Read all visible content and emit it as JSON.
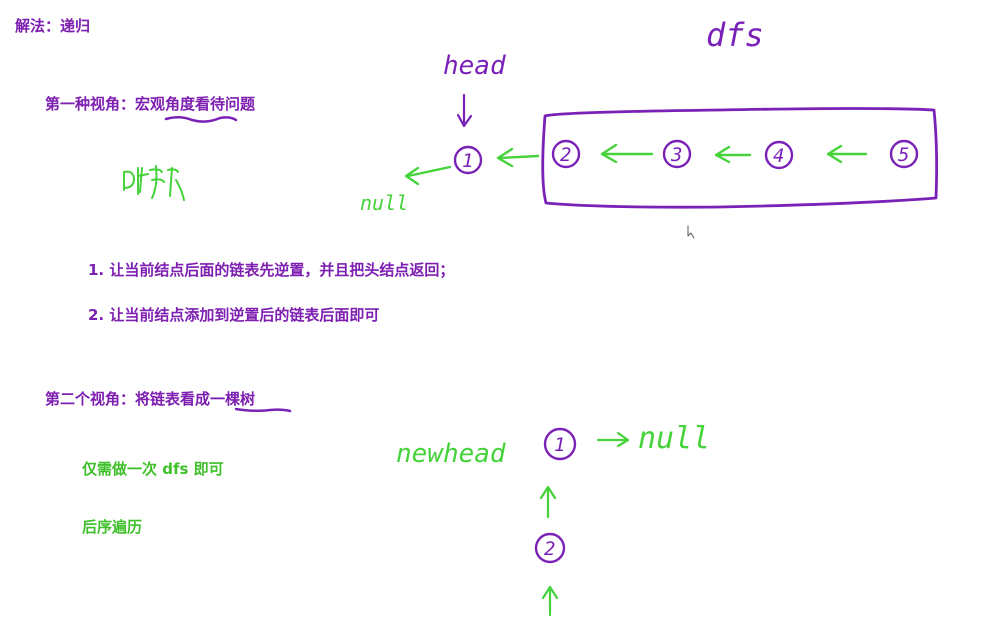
{
  "colors": {
    "purple": "#7d1fb0",
    "green": "#3fc02a",
    "ink_purple": "#7a22b8",
    "ink_green": "#45d23a"
  },
  "title": "解法：递归",
  "perspective1": {
    "heading_prefix": "第一种视角：",
    "heading_emph": "宏观角度",
    "heading_suffix": "看待问题",
    "step1": "1. 让当前结点后面的链表先逆置，并且把头结点返回；",
    "step2": "2. 让当前结点添加到逆置后的链表后面即可"
  },
  "perspective2": {
    "heading_prefix": "第二个视角：将链表看成",
    "heading_emph": "一棵树",
    "note1": "仅需做一次 dfs 即可",
    "note2": "后序遍历"
  },
  "diagram1": {
    "head_label": "head",
    "dfs_label": "dfs",
    "null_label": "null",
    "nodes": [
      "1",
      "2",
      "3",
      "4",
      "5"
    ]
  },
  "diagram2": {
    "newhead_label": "newhead",
    "null_label": "null",
    "nodes": [
      "1",
      "2"
    ]
  }
}
